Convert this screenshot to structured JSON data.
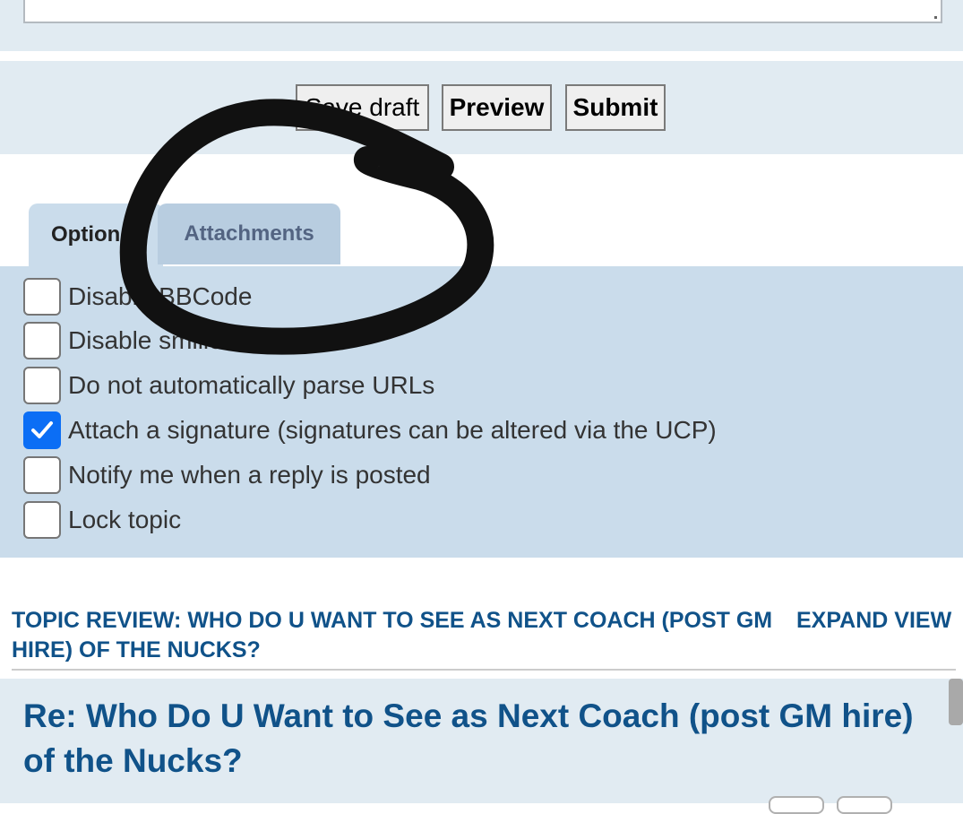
{
  "buttons": {
    "save_draft": "Save draft",
    "preview": "Preview",
    "submit": "Submit"
  },
  "tabs": [
    {
      "label": "Options",
      "active": true
    },
    {
      "label": "Attachments",
      "active": false
    }
  ],
  "options": [
    {
      "label": "Disable BBCode",
      "checked": false
    },
    {
      "label": "Disable smilies",
      "checked": false
    },
    {
      "label": "Do not automatically parse URLs",
      "checked": false
    },
    {
      "label": "Attach a signature (signatures can be altered via the UCP)",
      "checked": true
    },
    {
      "label": "Notify me when a reply is posted",
      "checked": false
    },
    {
      "label": "Lock topic",
      "checked": false
    }
  ],
  "review": {
    "title": "Topic review: Who Do U Want to See as Next Coach (post GM hire) of the Nucks?",
    "expand_link": "EXPAND VIEW"
  },
  "post": {
    "title": "Re: Who Do U Want to See as Next Coach (post GM hire) of the Nucks?"
  },
  "colors": {
    "panel_light": "#e1ebf2",
    "panel_options": "#cadceb",
    "link_blue": "#105289",
    "checkbox_checked": "#0b6ef5",
    "scribble": "#111111"
  }
}
